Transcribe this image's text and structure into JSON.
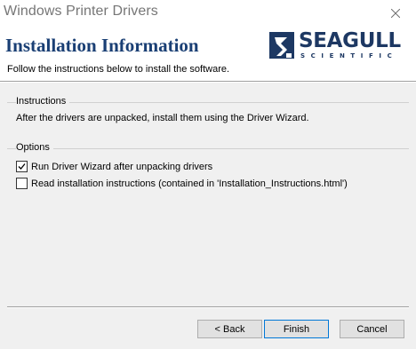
{
  "window": {
    "title": "Windows Printer Drivers"
  },
  "header": {
    "title": "Installation Information",
    "subtitle": "Follow the instructions below to install the software.",
    "logo": {
      "word": "SEAGULL",
      "sub": "SCIENTIFIC",
      "color": "#1d3863"
    }
  },
  "instructions": {
    "group_label": "Instructions",
    "text": "After the drivers are unpacked, install them using the Driver Wizard."
  },
  "options": {
    "group_label": "Options",
    "items": [
      {
        "label": "Run Driver Wizard after unpacking drivers",
        "checked": true
      },
      {
        "label": "Read installation instructions (contained in 'Installation_Instructions.html')",
        "checked": false
      }
    ]
  },
  "buttons": {
    "back": "< Back",
    "finish": "Finish",
    "cancel": "Cancel"
  },
  "colors": {
    "header_title": "#1a3f74",
    "background": "#f0f0f0"
  }
}
